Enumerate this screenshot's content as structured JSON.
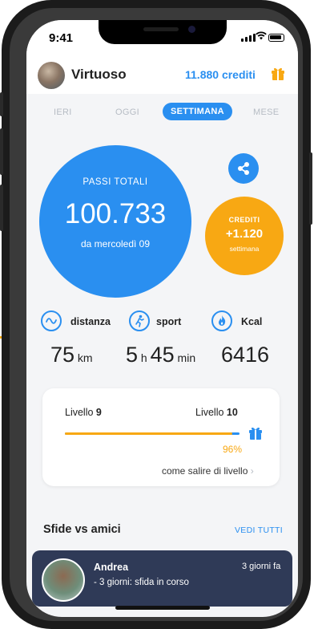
{
  "status_bar": {
    "time": "9:41"
  },
  "header": {
    "username": "Virtuoso",
    "credits": "11.880 crediti",
    "gift_icon": "gift-icon",
    "accent_color": "#2a8ff0",
    "gift_color": "#f8a813"
  },
  "tabs": [
    {
      "label": "IERI",
      "active": false
    },
    {
      "label": "OGGI",
      "active": false
    },
    {
      "label": "SETTIMANA",
      "active": true
    },
    {
      "label": "MESE",
      "active": false
    }
  ],
  "steps": {
    "label": "PASSI TOTALI",
    "value": "100.733",
    "since": "da mercoledì 09"
  },
  "credits_card": {
    "label": "CREDITI",
    "value": "+1.120",
    "period": "settimana"
  },
  "stats": [
    {
      "icon": "wave-icon",
      "title": "distanza",
      "value_parts": [
        "75",
        " km"
      ]
    },
    {
      "icon": "running-icon",
      "title": "sport",
      "value_parts": [
        "5",
        " h ",
        "45",
        " min"
      ]
    },
    {
      "icon": "flame-icon",
      "title": "Kcal",
      "value_parts": [
        "6416"
      ]
    }
  ],
  "level": {
    "current_prefix": "Livello ",
    "current_num": "9",
    "next_prefix": "Livello ",
    "next_num": "10",
    "progress_fraction": 0.96,
    "percent_label": "96%",
    "how_to_link": "come salire di livello"
  },
  "challenges": {
    "title": "Sfide vs amici",
    "see_all": "VEDI TUTTI",
    "items": [
      {
        "name": "Andrea",
        "time": "3 giorni fa",
        "status": "- 3 giorni: sfida in corso"
      }
    ]
  }
}
